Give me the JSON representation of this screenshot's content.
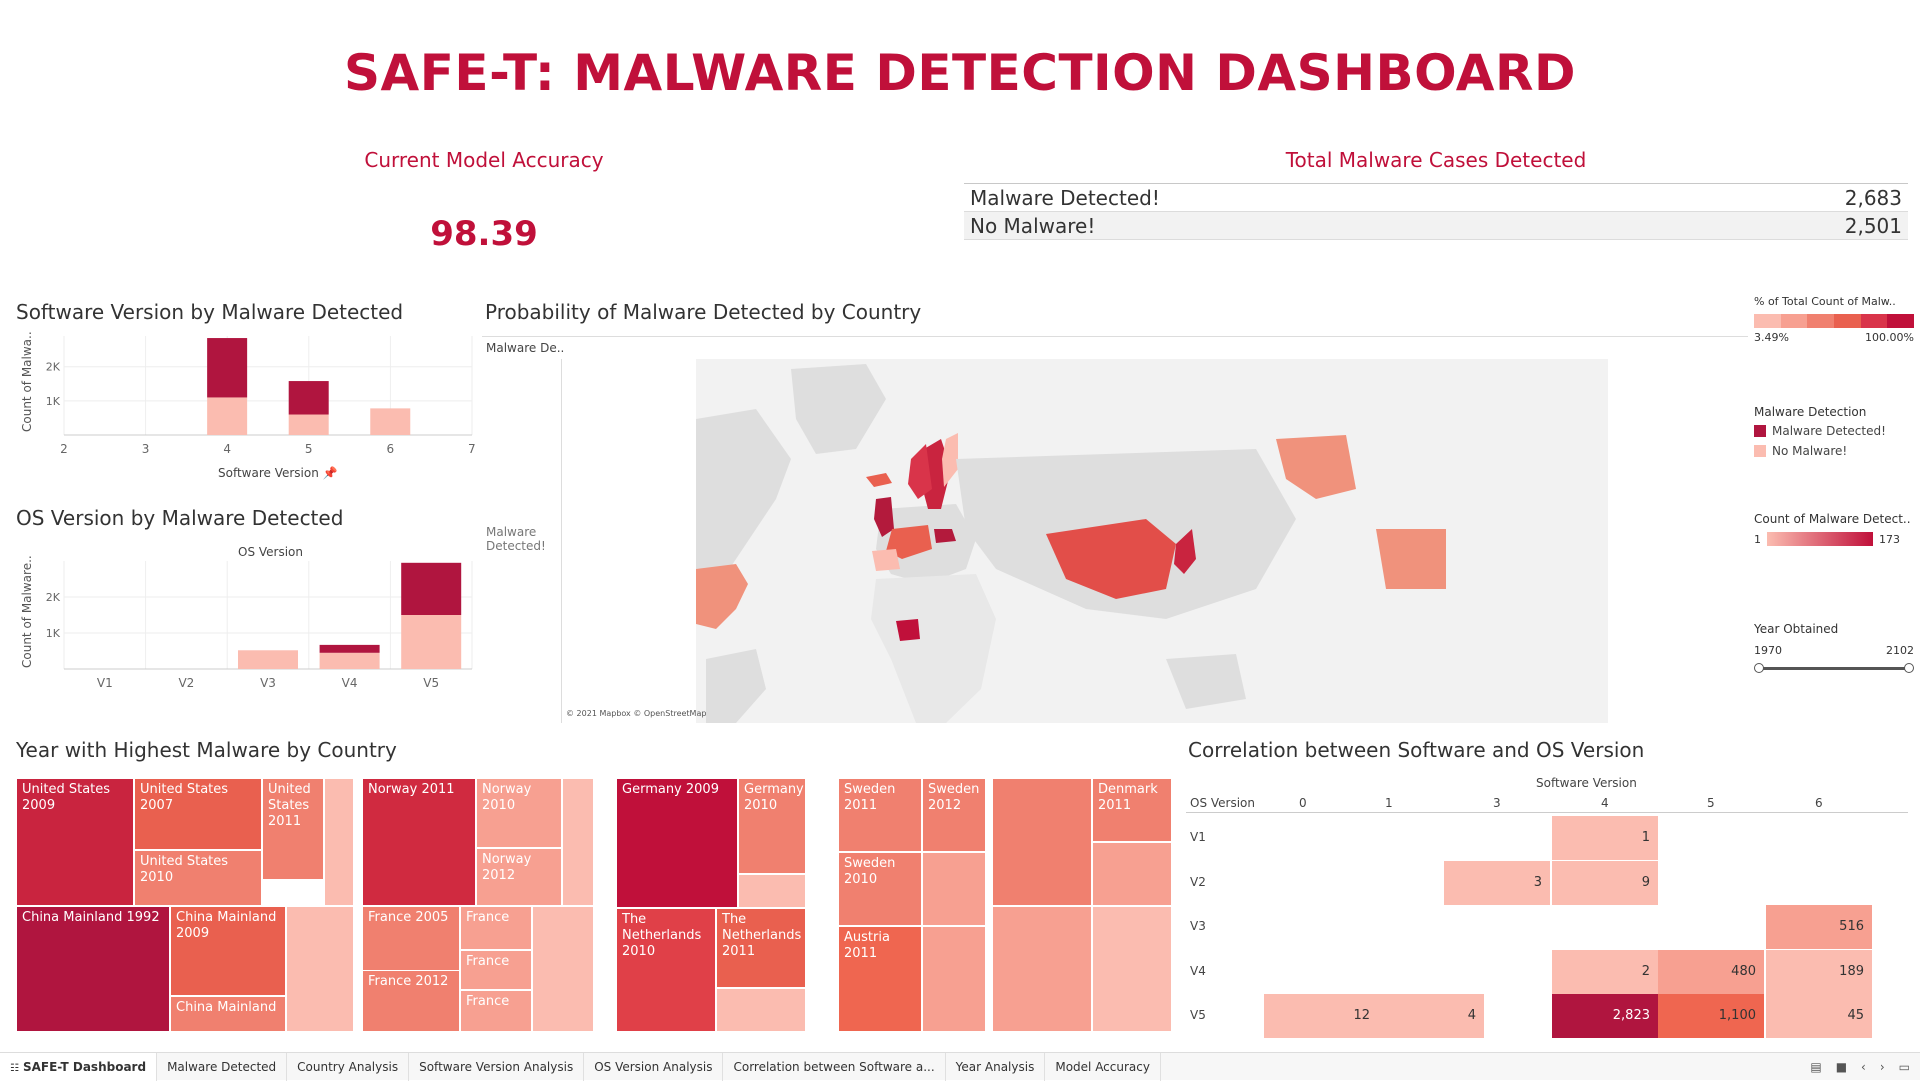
{
  "dashboard": {
    "title": "SAFE-T: MALWARE DETECTION DASHBOARD"
  },
  "accuracy": {
    "title": "Current Model Accuracy",
    "value": "98.39"
  },
  "cases": {
    "title": "Total Malware Cases Detected",
    "rows": [
      {
        "label": "Malware Detected!",
        "value": "2,683"
      },
      {
        "label": "No Malware!",
        "value": "2,501"
      }
    ]
  },
  "software_chart": {
    "title": "Software Version by Malware Detected",
    "ylabel": "Count of Malwa..",
    "xlabel": "Software Version",
    "pin_icon": "pin-icon"
  },
  "os_chart": {
    "title": "OS Version by Malware Detected",
    "ylabel": "Count of Malware..",
    "xlabel": "OS Version"
  },
  "map": {
    "title": "Probability of Malware Detected by Country",
    "row_header": "Malware De..",
    "row_label": "Malware Detected!",
    "attribution": "© 2021 Mapbox © OpenStreetMap"
  },
  "legends": {
    "pct": {
      "title": "% of Total Count of Malw..",
      "min": "3.49%",
      "max": "100.00%"
    },
    "detection": {
      "title": "Malware Detection",
      "items": [
        "Malware Detected!",
        "No Malware!"
      ]
    },
    "count": {
      "title": "Count of Malware Detect..",
      "min": "1",
      "max": "173"
    },
    "year": {
      "title": "Year Obtained",
      "min": "1970",
      "max": "2102"
    }
  },
  "treemap": {
    "title": "Year with Highest Malware by Country",
    "cells": [
      "United States 2009",
      "United States 2007",
      "United States 2011",
      "United States 2010",
      "China Mainland 1992",
      "China Mainland 2009",
      "China Mainland",
      "Norway 2011",
      "Norway 2010",
      "Norway 2012",
      "France 2005",
      "France",
      "France",
      "France 2012",
      "France",
      "Germany 2009",
      "Germany 2010",
      "The Netherlands 2010",
      "The Netherlands 2011",
      "Sweden 2011",
      "Sweden 2012",
      "Sweden 2010",
      "Austria 2011",
      "Denmark 2011"
    ]
  },
  "correlation": {
    "title": "Correlation between Software and OS Version",
    "col_header": "Software Version",
    "row_header": "OS Version",
    "columns": [
      "0",
      "1",
      "3",
      "4",
      "5",
      "6"
    ],
    "rows": [
      "V1",
      "V2",
      "V3",
      "V4",
      "V5"
    ],
    "values": [
      {
        "row": "V1",
        "col": "4",
        "value": "1"
      },
      {
        "row": "V2",
        "col": "3",
        "value": "3"
      },
      {
        "row": "V2",
        "col": "4",
        "value": "9"
      },
      {
        "row": "V3",
        "col": "6",
        "value": "516"
      },
      {
        "row": "V4",
        "col": "4",
        "value": "2"
      },
      {
        "row": "V4",
        "col": "5",
        "value": "480"
      },
      {
        "row": "V4",
        "col": "6",
        "value": "189"
      },
      {
        "row": "V5",
        "col": "1",
        "value": "12"
      },
      {
        "row": "V5",
        "col": "1b",
        "value": "4"
      },
      {
        "row": "V5",
        "col": "4",
        "value": "2,823"
      },
      {
        "row": "V5",
        "col": "5",
        "value": "1,100"
      },
      {
        "row": "V5",
        "col": "6",
        "value": "45"
      }
    ]
  },
  "tabs": [
    "SAFE-T Dashboard",
    "Malware Detected",
    "Country Analysis",
    "Software Version Analysis",
    "OS Version Analysis",
    "Correlation between Software a...",
    "Year Analysis",
    "Model Accuracy"
  ],
  "colors": {
    "brand": "#c0103a",
    "detected": "#b0153f",
    "no_malware": "#fbbcb0"
  },
  "chart_data": [
    {
      "type": "bar",
      "title": "Software Version by Malware Detected",
      "xlabel": "Software Version",
      "ylabel": "Count of Malwa..",
      "categories": [
        "2",
        "3",
        "4",
        "5",
        "6",
        "7"
      ],
      "series": [
        {
          "name": "No Malware!",
          "values": [
            0,
            0,
            1100,
            600,
            780,
            0
          ]
        },
        {
          "name": "Malware Detected!",
          "values": [
            0,
            0,
            1740,
            980,
            0,
            0
          ]
        }
      ],
      "yticks": [
        "1K",
        "2K"
      ],
      "ylim": [
        0,
        2900
      ]
    },
    {
      "type": "bar",
      "title": "OS Version by Malware Detected",
      "xlabel": "OS Version",
      "ylabel": "Count of Malware..",
      "categories": [
        "V1",
        "V2",
        "V3",
        "V4",
        "V5"
      ],
      "series": [
        {
          "name": "No Malware!",
          "values": [
            0,
            0,
            520,
            450,
            1500
          ]
        },
        {
          "name": "Malware Detected!",
          "values": [
            0,
            0,
            0,
            220,
            1450
          ]
        }
      ],
      "yticks": [
        "1K",
        "2K"
      ],
      "ylim": [
        0,
        3000
      ]
    }
  ]
}
